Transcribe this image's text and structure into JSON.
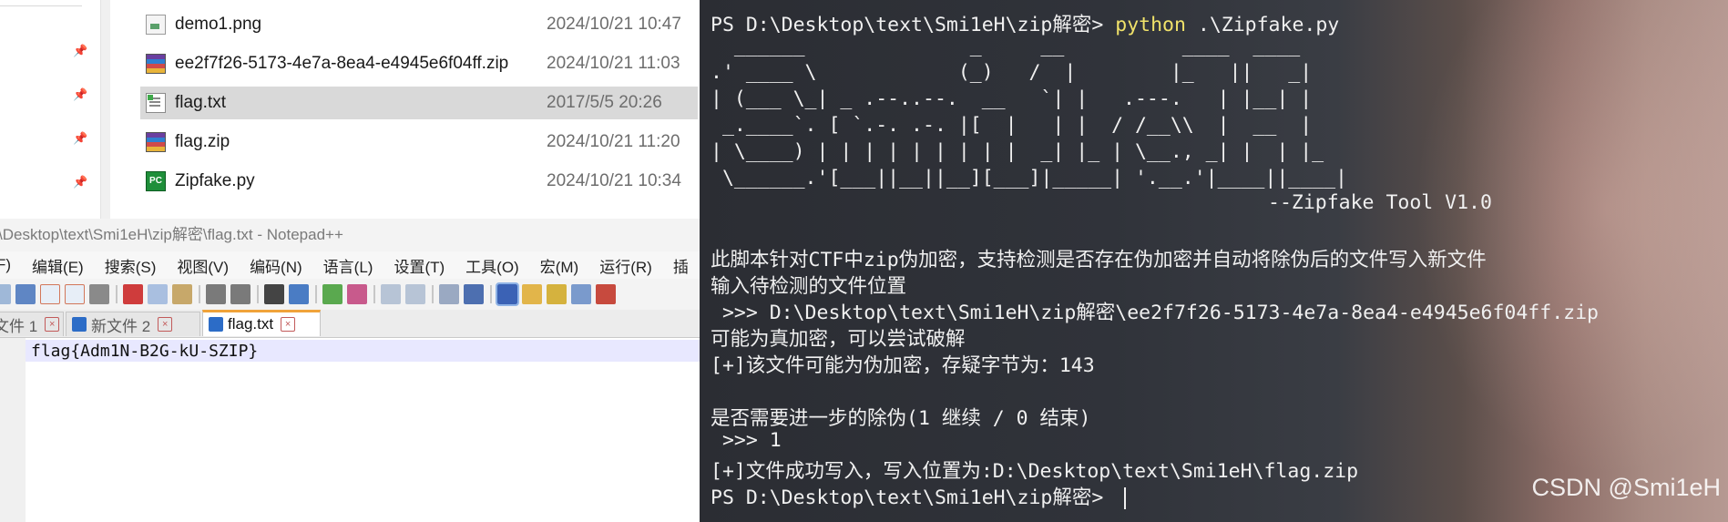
{
  "explorer": {
    "files": [
      {
        "name": "demo1.png",
        "date": "2024/10/21 10:47",
        "icon": "png-file-icon"
      },
      {
        "name": "ee2f7f26-5173-4e7a-8ea4-e4945e6f04ff.zip",
        "date": "2024/10/21 11:03",
        "icon": "zip-archive-icon"
      },
      {
        "name": "flag.txt",
        "date": "2017/5/5 20:26",
        "icon": "text-file-icon",
        "selected": true
      },
      {
        "name": "flag.zip",
        "date": "2024/10/21 11:20",
        "icon": "zip-archive-icon"
      },
      {
        "name": "Zipfake.py",
        "date": "2024/10/21 10:34",
        "icon": "python-file-icon"
      }
    ]
  },
  "notepad": {
    "title": "\\Desktop\\text\\Smi1eH\\zip解密\\flag.txt - Notepad++",
    "menu": [
      "F)",
      "编辑(E)",
      "搜索(S)",
      "视图(V)",
      "编码(N)",
      "语言(L)",
      "设置(T)",
      "工具(O)",
      "宏(M)",
      "运行(R)",
      "插"
    ],
    "tabs": [
      {
        "label": "文件 1",
        "active": false
      },
      {
        "label": "新文件 2",
        "active": false
      },
      {
        "label": "flag.txt",
        "active": true
      }
    ],
    "content": "flag{Adm1N-B2G-kU-SZIP}"
  },
  "terminal": {
    "prompt1": "PS D:\\Desktop\\text\\Smi1eH\\zip解密> ",
    "command": "python",
    "command_arg": " .\\Zipfake.py",
    "ascii_art": "  ______              _     __          ____  ____\n.' ____ \\            (_)   /  |        |_   ||   _|\n| (___ \\_| _ .--..--.  __   `| |   .---.   | |__| |\n _.____`. [ `.-. .-. |[  |   | |  / /__\\\\  |  __  |\n| \\____) | | | | | | | | |  _| |_ | \\__., _| |  | |_\n \\______.'[___||__||__][___]|_____| '.__.'|____||____|",
    "ascii_subtitle": "--Zipfake Tool V1.0",
    "description": "此脚本针对CTF中zip伪加密，支持检测是否存在伪加密并自动将除伪后的文件写入新文件",
    "input_prompt": "输入待检测的文件位置",
    "input_path": " >>> D:\\Desktop\\text\\Smi1eH\\zip解密\\ee2f7f26-5173-4e7a-8ea4-e4945e6f04ff.zip",
    "maybe_real": "可能为真加密，可以尝试破解",
    "suspicious": "[+]该文件可能为伪加密，存疑字节为：143",
    "continue_prompt": "是否需要进一步的除伪(1 继续 / 0 结束)",
    "continue_answer": " >>> 1",
    "success": "[+]文件成功写入，写入位置为:D:\\Desktop\\text\\Smi1eH\\flag.zip",
    "prompt2": "PS D:\\Desktop\\text\\Smi1eH\\zip解密> ",
    "watermark": "CSDN @Smi1eH"
  }
}
